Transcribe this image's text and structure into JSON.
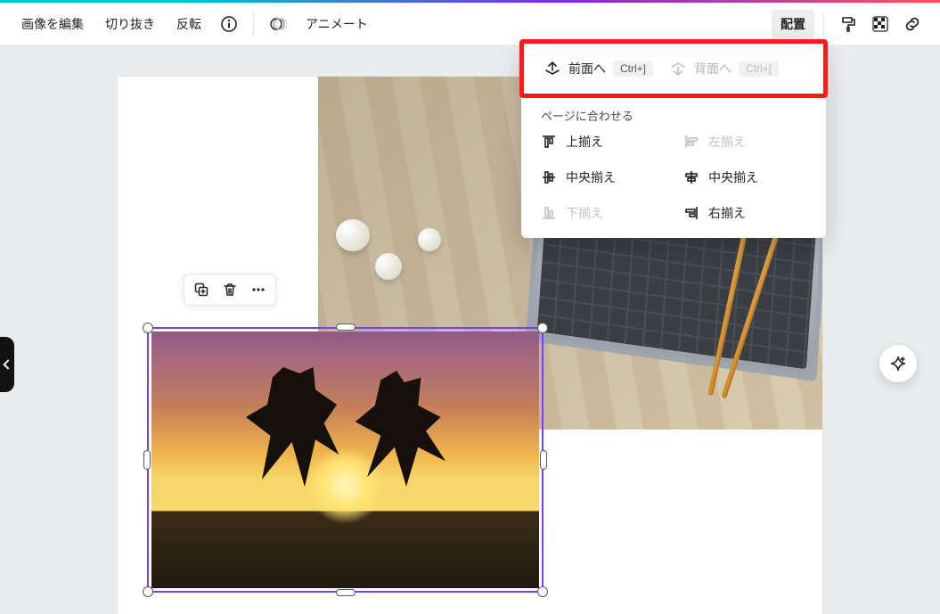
{
  "toolbar": {
    "edit_image": "画像を編集",
    "crop": "切り抜き",
    "flip": "反転",
    "animate": "アニメート",
    "position": "配置"
  },
  "popover": {
    "bring_forward": "前面へ",
    "bring_forward_kbd": "Ctrl+]",
    "send_backward": "背面へ",
    "send_backward_kbd": "Ctrl+[",
    "fit_to_page": "ページに合わせる",
    "align_top": "上揃え",
    "align_left": "左揃え",
    "align_middle_h": "中央揃え",
    "align_middle_v": "中央揃え",
    "align_bottom": "下揃え",
    "align_right": "右揃え"
  }
}
